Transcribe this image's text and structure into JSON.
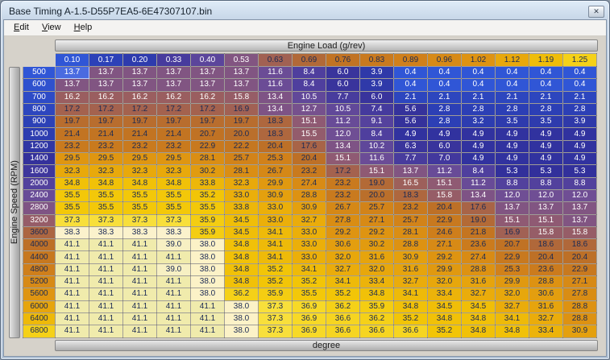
{
  "window": {
    "title": "Base Timing A-1.5-D55P7EA5-6E47307107.bin"
  },
  "icons": {
    "close": "✕"
  },
  "menu": {
    "items": [
      {
        "label": "Edit"
      },
      {
        "label": "View"
      },
      {
        "label": "Help"
      }
    ]
  },
  "axes": {
    "x_title": "Engine Load (g/rev)",
    "y_title": "Engine Speed (RPM)",
    "unit_label": "degree"
  },
  "chart_data": {
    "type": "heatmap",
    "title": "Base Timing",
    "unit": "degree",
    "x_axis": {
      "label": "Engine Load (g/rev)",
      "ticks": [
        "0.10",
        "0.17",
        "0.20",
        "0.33",
        "0.40",
        "0.53",
        "0.63",
        "0.69",
        "0.76",
        "0.83",
        "0.89",
        "0.96",
        "1.02",
        "1.12",
        "1.19",
        "1.25"
      ]
    },
    "y_axis": {
      "label": "Engine Speed (RPM)",
      "ticks": [
        500,
        600,
        700,
        800,
        900,
        1000,
        1200,
        1400,
        1600,
        2000,
        2400,
        2800,
        3200,
        3600,
        4000,
        4400,
        4800,
        5200,
        5600,
        6000,
        6400,
        6800
      ]
    },
    "value_range": {
      "min": 0.4,
      "max": 41.1
    },
    "selected_cell": {
      "row_index": 0,
      "col_index": 0,
      "value": 13.7
    },
    "values": [
      [
        13.7,
        13.7,
        13.7,
        13.7,
        13.7,
        13.7,
        11.6,
        8.4,
        6.0,
        3.9,
        0.4,
        0.4,
        0.4,
        0.4,
        0.4,
        0.4
      ],
      [
        13.7,
        13.7,
        13.7,
        13.7,
        13.7,
        13.7,
        11.6,
        8.4,
        6.0,
        3.9,
        0.4,
        0.4,
        0.4,
        0.4,
        0.4,
        0.4
      ],
      [
        16.2,
        16.2,
        16.2,
        16.2,
        16.2,
        15.8,
        13.4,
        10.5,
        7.7,
        6.0,
        2.1,
        2.1,
        2.1,
        2.1,
        2.1,
        2.1
      ],
      [
        17.2,
        17.2,
        17.2,
        17.2,
        17.2,
        16.9,
        13.4,
        12.7,
        10.5,
        7.4,
        5.6,
        2.8,
        2.8,
        2.8,
        2.8,
        2.8
      ],
      [
        19.7,
        19.7,
        19.7,
        19.7,
        19.7,
        19.7,
        18.3,
        15.1,
        11.2,
        9.1,
        5.6,
        2.8,
        3.2,
        3.5,
        3.5,
        3.9
      ],
      [
        21.4,
        21.4,
        21.4,
        21.4,
        20.7,
        20.0,
        18.3,
        15.5,
        12.0,
        8.4,
        4.9,
        4.9,
        4.9,
        4.9,
        4.9,
        4.9
      ],
      [
        23.2,
        23.2,
        23.2,
        23.2,
        22.9,
        22.2,
        20.4,
        17.6,
        13.4,
        10.2,
        6.3,
        6.0,
        4.9,
        4.9,
        4.9,
        4.9
      ],
      [
        29.5,
        29.5,
        29.5,
        29.5,
        28.1,
        25.7,
        25.3,
        20.4,
        15.1,
        11.6,
        7.7,
        7.0,
        4.9,
        4.9,
        4.9,
        4.9
      ],
      [
        32.3,
        32.3,
        32.3,
        32.3,
        30.2,
        28.1,
        26.7,
        23.2,
        17.2,
        15.1,
        13.7,
        11.2,
        8.4,
        5.3,
        5.3,
        5.3
      ],
      [
        34.8,
        34.8,
        34.8,
        34.8,
        33.8,
        32.3,
        29.9,
        27.4,
        23.2,
        19.0,
        16.5,
        15.1,
        11.2,
        8.8,
        8.8,
        8.8
      ],
      [
        35.5,
        35.5,
        35.5,
        35.5,
        35.2,
        33.0,
        30.9,
        28.8,
        23.2,
        20.0,
        18.3,
        15.8,
        13.4,
        12.0,
        12.0,
        12.0
      ],
      [
        35.5,
        35.5,
        35.5,
        35.5,
        35.5,
        33.8,
        33.0,
        30.9,
        26.7,
        25.7,
        23.2,
        20.4,
        17.6,
        13.7,
        13.7,
        13.7
      ],
      [
        37.3,
        37.3,
        37.3,
        37.3,
        35.9,
        34.5,
        33.0,
        32.7,
        27.8,
        27.1,
        25.7,
        22.9,
        19.0,
        15.1,
        15.1,
        13.7
      ],
      [
        38.3,
        38.3,
        38.3,
        38.3,
        35.9,
        34.5,
        34.1,
        33.0,
        29.2,
        29.2,
        28.1,
        24.6,
        21.8,
        16.9,
        15.8,
        15.8
      ],
      [
        41.1,
        41.1,
        41.1,
        39.0,
        38.0,
        34.8,
        34.1,
        33.0,
        30.6,
        30.2,
        28.8,
        27.1,
        23.6,
        20.7,
        18.6,
        18.6
      ],
      [
        41.1,
        41.1,
        41.1,
        41.1,
        38.0,
        34.8,
        34.1,
        33.0,
        32.0,
        31.6,
        30.9,
        29.2,
        27.4,
        22.9,
        20.4,
        20.4
      ],
      [
        41.1,
        41.1,
        41.1,
        39.0,
        38.0,
        34.8,
        35.2,
        34.1,
        32.7,
        32.0,
        31.6,
        29.9,
        28.8,
        25.3,
        23.6,
        22.9
      ],
      [
        41.1,
        41.1,
        41.1,
        41.1,
        38.0,
        34.8,
        35.2,
        35.2,
        34.1,
        33.4,
        32.7,
        32.0,
        31.6,
        29.9,
        28.8,
        27.1
      ],
      [
        41.1,
        41.1,
        41.1,
        41.1,
        38.0,
        36.2,
        35.9,
        35.5,
        35.2,
        34.8,
        34.1,
        33.4,
        32.7,
        32.0,
        30.6,
        27.8
      ],
      [
        41.1,
        41.1,
        41.1,
        41.1,
        41.1,
        38.0,
        37.3,
        36.9,
        36.2,
        35.9,
        34.8,
        34.5,
        34.5,
        32.7,
        31.6,
        28.8
      ],
      [
        41.1,
        41.1,
        41.1,
        41.1,
        41.1,
        38.0,
        37.3,
        36.9,
        36.6,
        36.2,
        35.2,
        34.8,
        34.8,
        34.1,
        32.7,
        28.8
      ],
      [
        41.1,
        41.1,
        41.1,
        41.1,
        41.1,
        38.0,
        37.3,
        36.9,
        36.6,
        36.6,
        36.6,
        35.2,
        34.8,
        34.8,
        33.4,
        30.9
      ]
    ]
  },
  "colors": {
    "colormap": [
      {
        "t": 0.0,
        "c": "#3056d6"
      },
      {
        "t": 0.06,
        "c": "#2c3fb4"
      },
      {
        "t": 0.12,
        "c": "#32309b"
      },
      {
        "t": 0.2,
        "c": "#50409e"
      },
      {
        "t": 0.28,
        "c": "#6d4d96"
      },
      {
        "t": 0.36,
        "c": "#8f5a74"
      },
      {
        "t": 0.43,
        "c": "#ab6542"
      },
      {
        "t": 0.5,
        "c": "#c07223"
      },
      {
        "t": 0.6,
        "c": "#cf7f1b"
      },
      {
        "t": 0.7,
        "c": "#dd9212"
      },
      {
        "t": 0.79,
        "c": "#e9ab0b"
      },
      {
        "t": 0.86,
        "c": "#f3c707"
      },
      {
        "t": 0.905,
        "c": "#f8dd2e"
      },
      {
        "t": 0.925,
        "c": "#fcf3d0"
      },
      {
        "t": 0.96,
        "c": "#f4efbc"
      },
      {
        "t": 1.0,
        "c": "#f0ebac"
      }
    ],
    "text_dark": "#1b2a55",
    "text_light": "#ffffff",
    "selected_bg": "#4a6be0",
    "selected_border": "#b9cdf9"
  }
}
